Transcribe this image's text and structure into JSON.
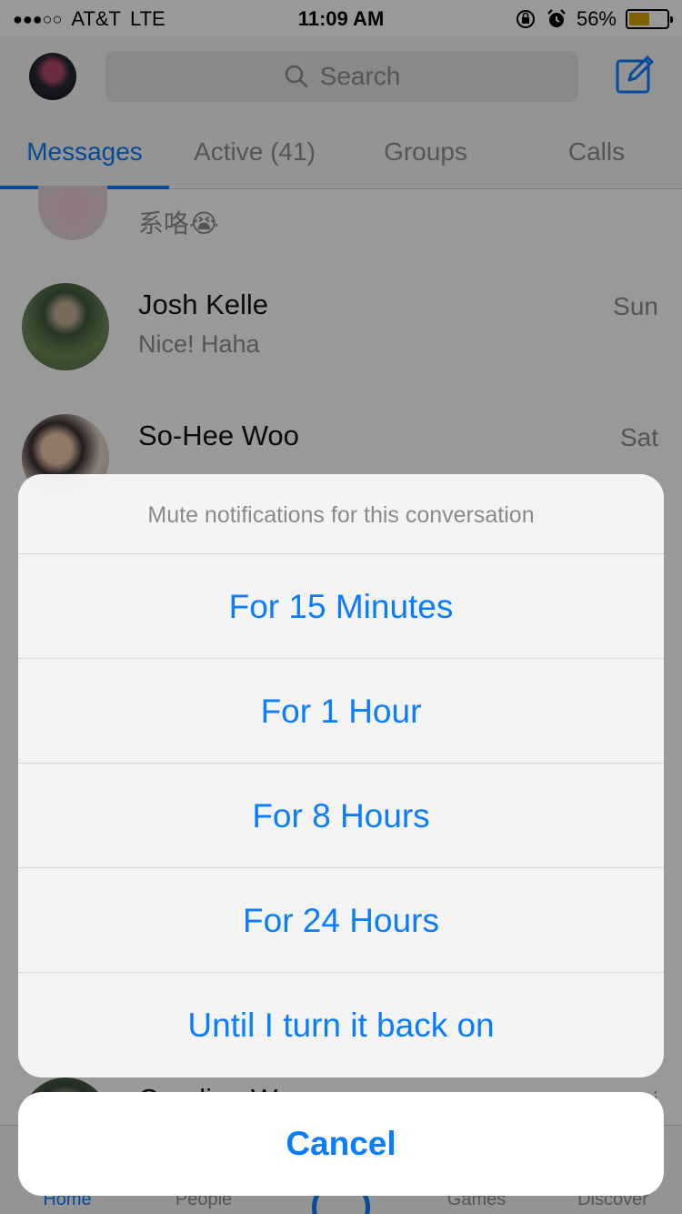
{
  "status_bar": {
    "signal": "●●●○○",
    "carrier": "AT&T",
    "network": "LTE",
    "time": "11:09 AM",
    "battery": "56%",
    "battery_level": 0.56
  },
  "header": {
    "search_placeholder": "Search"
  },
  "tabs": [
    {
      "label": "Messages",
      "active": true
    },
    {
      "label": "Active (41)",
      "active": false
    },
    {
      "label": "Groups",
      "active": false
    },
    {
      "label": "Calls",
      "active": false
    }
  ],
  "conversations": [
    {
      "name": "",
      "snippet": "系咯😭",
      "time": ""
    },
    {
      "name": "Josh Kelle",
      "snippet": "Nice! Haha",
      "time": "Sun"
    },
    {
      "name": "So-Hee Woo",
      "snippet": "",
      "time": "Sat"
    },
    {
      "name": "Caroline Wesson",
      "snippet": "",
      "time": "Fri"
    }
  ],
  "action_sheet": {
    "title": "Mute notifications for this conversation",
    "options": [
      "For 15 Minutes",
      "For 1 Hour",
      "For 8 Hours",
      "For 24 Hours",
      "Until I turn it back on"
    ],
    "cancel_label": "Cancel"
  },
  "bottom_nav": [
    {
      "label": "Home",
      "active": true
    },
    {
      "label": "People",
      "active": false
    },
    {
      "label": "Games",
      "active": false
    },
    {
      "label": "Discover",
      "active": false
    }
  ],
  "colors": {
    "accent": "#0a7cff",
    "battery": "#d8a300"
  }
}
